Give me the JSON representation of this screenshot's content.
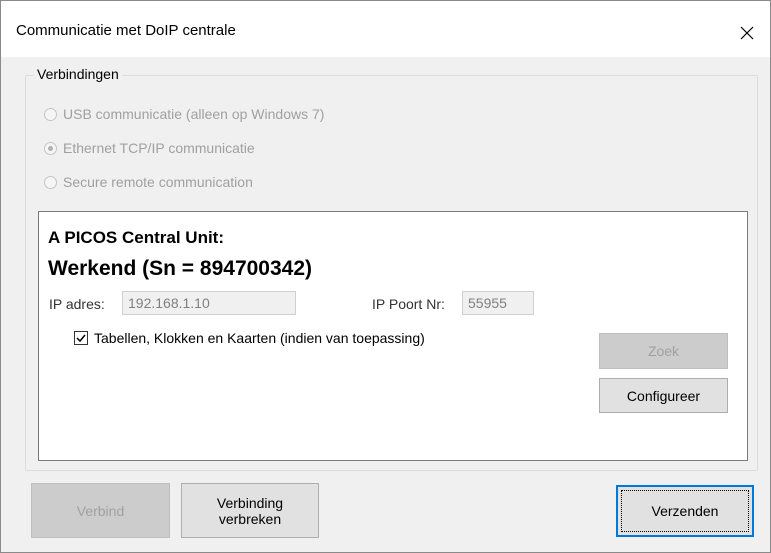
{
  "window": {
    "title": "Communicatie met DoIP centrale",
    "close_glyph": "close-icon"
  },
  "connections": {
    "group_label": "Verbindingen",
    "options": [
      {
        "label": "USB communicatie (alleen op Windows 7)",
        "checked": false,
        "enabled": false
      },
      {
        "label": "Ethernet TCP/IP communicatie",
        "checked": true,
        "enabled": false
      },
      {
        "label": "Secure remote communication",
        "checked": false,
        "enabled": false
      }
    ]
  },
  "unit": {
    "title": "A PICOS Central Unit:",
    "status": "Werkend (Sn = 894700342)",
    "ip_label": "IP adres:",
    "ip_value": "192.168.1.10",
    "port_label": "IP Poort Nr:",
    "port_value": "55955",
    "tables_checkbox_label": "Tabellen, Klokken en Kaarten (indien van toepassing)",
    "tables_checked": true,
    "search_button": "Zoek",
    "configure_button": "Configureer"
  },
  "footer": {
    "connect_button": "Verbind",
    "disconnect_button_line1": "Verbinding",
    "disconnect_button_line2": "verbreken",
    "send_button": "Verzenden"
  },
  "colors": {
    "accent": "#0078d7",
    "disabled_text": "#a0a0a0"
  }
}
